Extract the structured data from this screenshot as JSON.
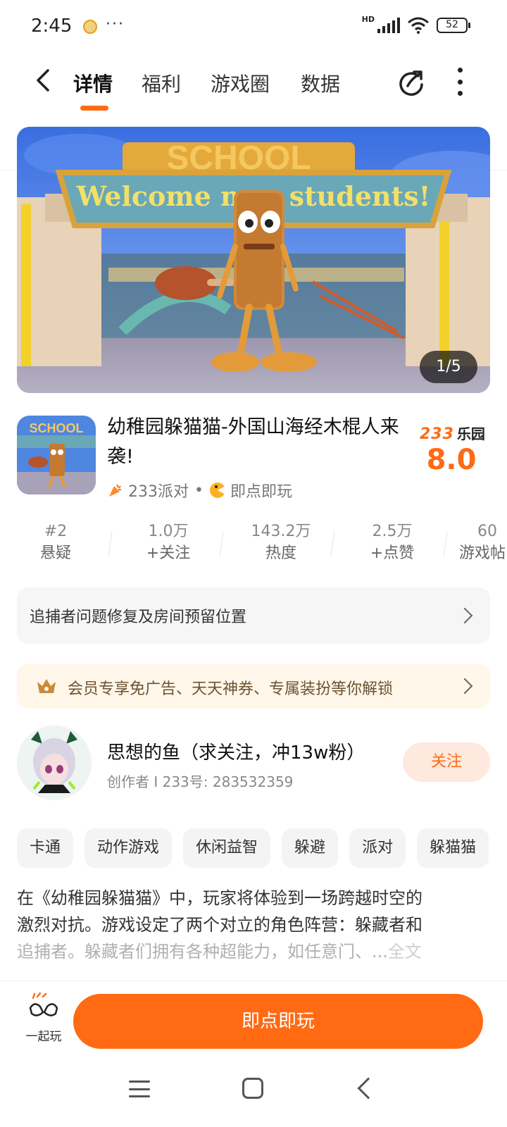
{
  "status_bar": {
    "time": "2:45",
    "more": "···",
    "network": "HD",
    "battery": "52"
  },
  "header": {
    "tabs": [
      {
        "label": "详情",
        "active": true
      },
      {
        "label": "福利",
        "active": false
      },
      {
        "label": "游戏圈",
        "active": false
      },
      {
        "label": "数据",
        "active": false
      }
    ],
    "accent_color": "#ff6a13"
  },
  "banner": {
    "sign_top": "SCHOOL",
    "sign_text": "Welcome new students!",
    "counter": "1/5"
  },
  "game": {
    "title": "幼稚园躲猫猫-外国山海经木棍人来袭!",
    "icon_sign": "SCHOOL",
    "publisher": "233派对",
    "separator": "•",
    "play_type": "即点即玩",
    "brand_num": "233",
    "brand_name": "乐园",
    "score": "8.0"
  },
  "stats": [
    {
      "value": "#2",
      "label": "悬疑"
    },
    {
      "value": "1.0万",
      "label": "+关注"
    },
    {
      "value": "143.2万",
      "label": "热度"
    },
    {
      "value": "2.5万",
      "label": "+点赞"
    },
    {
      "value": "60",
      "label": "游戏帖"
    }
  ],
  "update_notice": "追捕者问题修复及房间预留位置",
  "vip_notice": "会员专享免广告、天天神券、专属装扮等你解锁",
  "creator": {
    "name": "思想的鱼（求关注，冲13w粉）",
    "info": "创作者 I 233号: 283532359",
    "follow_label": "关注"
  },
  "tags": [
    "卡通",
    "动作游戏",
    "休闲益智",
    "躲避",
    "派对",
    "躲猫猫"
  ],
  "description": {
    "line1": "在《幼稚园躲猫猫》中，玩家将体验到一场跨越时空的",
    "line2": "激烈对抗。游戏设定了两个对立的角色阵营：躲藏者和",
    "line3": "追捕者。躲藏者们拥有各种超能力，如任意门、",
    "ellipsis": "...",
    "read_more": "全文"
  },
  "bottom_bar": {
    "play_together_label": "一起玩",
    "play_button": "即点即玩"
  }
}
